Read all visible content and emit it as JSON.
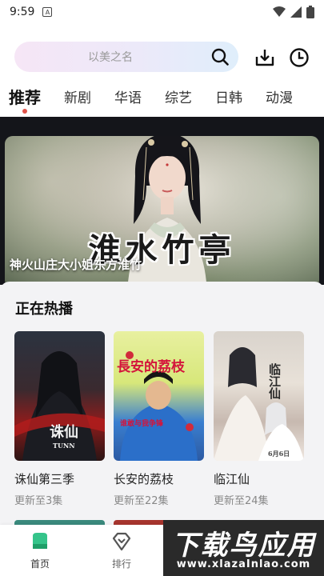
{
  "status_bar": {
    "time": "9:59",
    "notification_letter": "A"
  },
  "search": {
    "placeholder": "以美之名"
  },
  "tabs": [
    {
      "label": "推荐",
      "active": true
    },
    {
      "label": "新剧"
    },
    {
      "label": "华语"
    },
    {
      "label": "综艺"
    },
    {
      "label": "日韩"
    },
    {
      "label": "动漫"
    }
  ],
  "banner": {
    "title": "淮水竹亭",
    "caption": "神火山庄大小姐东方淮竹"
  },
  "hot": {
    "title": "正在热播",
    "items": [
      {
        "title": "诛仙第三季",
        "update": "更新至3集",
        "poster_text": "诛仙",
        "poster_sub": "TUNN"
      },
      {
        "title": "长安的荔枝",
        "update": "更新至22集",
        "poster_text": "長安的荔枝",
        "poster_sub": "谁敢与我争锋"
      },
      {
        "title": "临江仙",
        "update": "更新至24集",
        "poster_text": "临江仙",
        "poster_sub": "6月6日"
      }
    ]
  },
  "nav": {
    "home_label": "首页",
    "rank_label": "排行"
  },
  "watermark": {
    "main": "下载鸟应用",
    "sub": "www.xlazaInlao.com"
  },
  "colors": {
    "accent_green": "#35c48a",
    "tab_dot": "#e0534a"
  }
}
